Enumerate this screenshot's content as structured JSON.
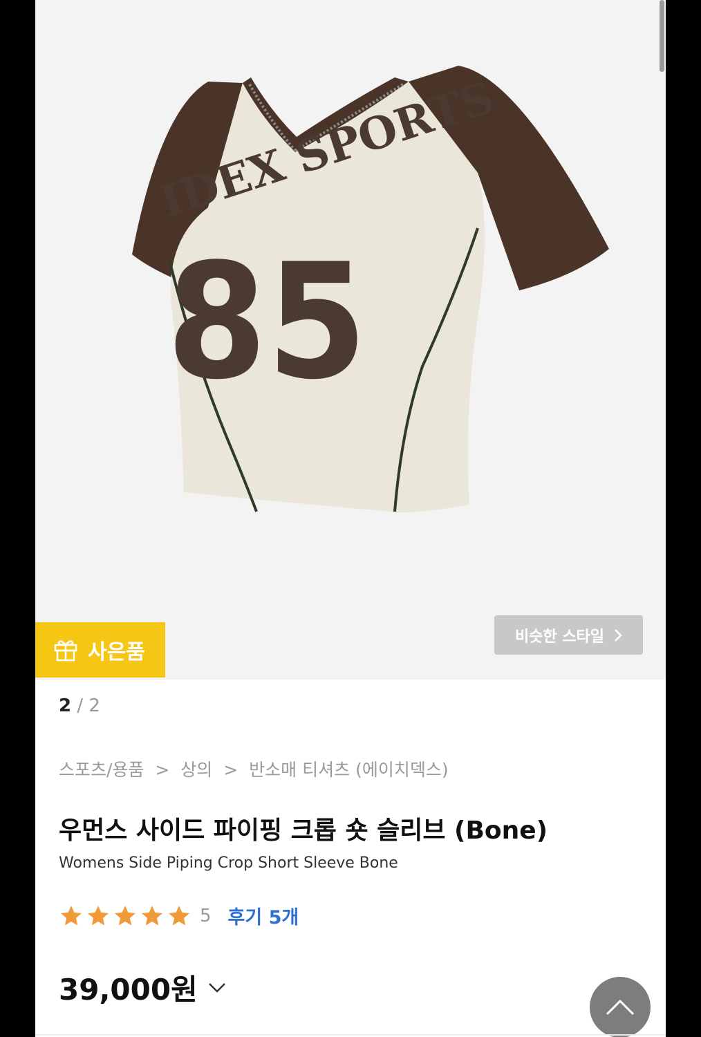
{
  "image": {
    "alt": "Womens Side Piping Crop Short Sleeve Bone",
    "print_text": "IDEX SPORTS",
    "print_number": "85"
  },
  "badges": {
    "gift_label": "사은품",
    "similar_label": "비슷한 스타일"
  },
  "pager": {
    "current": "2",
    "separator": "/",
    "total": "2"
  },
  "breadcrumb": {
    "items": [
      "스포츠/용품",
      "상의",
      "반소매 티셔츠 (에이치덱스)"
    ],
    "separator": ">"
  },
  "product": {
    "title": "우먼스 사이드 파이핑 크롭 숏 슬리브 (Bone)",
    "subtitle": "Womens Side Piping Crop Short Sleeve Bone",
    "rating_value": "5",
    "rating_fraction": 1.0,
    "review_label": "후기 5개",
    "price": "39,000원"
  },
  "colors": {
    "gift_badge": "#f6c615",
    "star": "#f09a3a",
    "review_link": "#2f6fd0",
    "shirt_body": "#ebe6da",
    "shirt_sleeve": "#4a3327"
  }
}
